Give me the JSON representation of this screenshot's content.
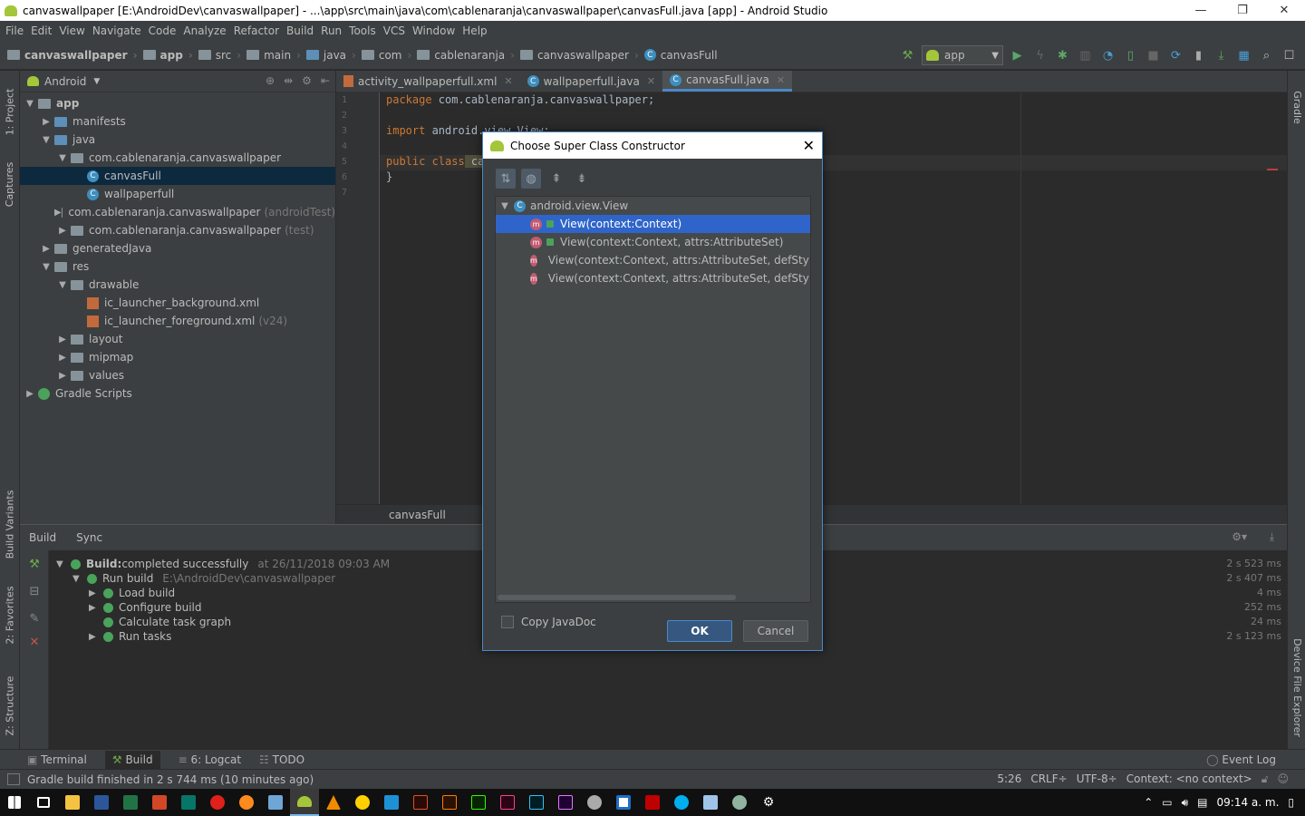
{
  "window": {
    "title": "canvaswallpaper [E:\\AndroidDev\\canvaswallpaper] - ...\\app\\src\\main\\java\\com\\cablenaranja\\canvaswallpaper\\canvasFull.java [app] - Android Studio",
    "minimize": "—",
    "maximize": "❐",
    "close": "✕"
  },
  "menu": [
    "File",
    "Edit",
    "View",
    "Navigate",
    "Code",
    "Analyze",
    "Refactor",
    "Build",
    "Run",
    "Tools",
    "VCS",
    "Window",
    "Help"
  ],
  "breadcrumbs": [
    "canvaswallpaper",
    "app",
    "src",
    "main",
    "java",
    "com",
    "cablenaranja",
    "canvaswallpaper",
    "canvasFull"
  ],
  "run_config": "app",
  "left_tabs": {
    "project": "1: Project",
    "captures": "Captures",
    "build_variants": "Build Variants",
    "favorites": "2: Favorites",
    "structure": "Z: Structure"
  },
  "right_tabs": {
    "gradle": "Gradle",
    "device_file_explorer": "Device File Explorer"
  },
  "project_panel": {
    "view_mode": "Android",
    "tree": [
      {
        "label": "app",
        "level": 0,
        "arrow": "▼",
        "icon": "folder",
        "bold": true
      },
      {
        "label": "manifests",
        "level": 1,
        "arrow": "▶",
        "icon": "folder-blue"
      },
      {
        "label": "java",
        "level": 1,
        "arrow": "▼",
        "icon": "folder-blue"
      },
      {
        "label": "com.cablenaranja.canvaswallpaper",
        "level": 2,
        "arrow": "▼",
        "icon": "package"
      },
      {
        "label": "canvasFull",
        "level": 3,
        "arrow": "",
        "icon": "class",
        "selected": true
      },
      {
        "label": "wallpaperfull",
        "level": 3,
        "arrow": "",
        "icon": "class"
      },
      {
        "label": "com.cablenaranja.canvaswallpaper",
        "level": 2,
        "arrow": "▶",
        "icon": "package",
        "suffix": "(androidTest)"
      },
      {
        "label": "com.cablenaranja.canvaswallpaper",
        "level": 2,
        "arrow": "▶",
        "icon": "package",
        "suffix": "(test)"
      },
      {
        "label": "generatedJava",
        "level": 1,
        "arrow": "▶",
        "icon": "folder"
      },
      {
        "label": "res",
        "level": 1,
        "arrow": "▼",
        "icon": "folder"
      },
      {
        "label": "drawable",
        "level": 2,
        "arrow": "▼",
        "icon": "folder"
      },
      {
        "label": "ic_launcher_background.xml",
        "level": 3,
        "arrow": "",
        "icon": "xml"
      },
      {
        "label": "ic_launcher_foreground.xml",
        "level": 3,
        "arrow": "",
        "icon": "xml",
        "suffix": "(v24)"
      },
      {
        "label": "layout",
        "level": 2,
        "arrow": "▶",
        "icon": "folder"
      },
      {
        "label": "mipmap",
        "level": 2,
        "arrow": "▶",
        "icon": "folder"
      },
      {
        "label": "values",
        "level": 2,
        "arrow": "▶",
        "icon": "folder"
      },
      {
        "label": "Gradle Scripts",
        "level": 0,
        "arrow": "▶",
        "icon": "gradle"
      }
    ]
  },
  "editor_tabs": [
    {
      "label": "activity_wallpaperfull.xml",
      "icon": "xml",
      "active": false
    },
    {
      "label": "wallpaperfull.java",
      "icon": "class",
      "active": false
    },
    {
      "label": "canvasFull.java",
      "icon": "class",
      "active": true
    }
  ],
  "code": {
    "line_numbers": [
      "1",
      "2",
      "3",
      "4",
      "5",
      "6",
      "7"
    ],
    "line1_kw": "package",
    "line1_rest": " com.cablenaranja.canvaswallpaper;",
    "line3_kw": "import",
    "line3_rest": " android.view.View;",
    "line5_kw": "public class",
    "line5_rest": " ca",
    "line6": "}"
  },
  "editor_breadcrumb": "canvasFull",
  "build_panel": {
    "tabs": [
      "Build",
      "Sync"
    ],
    "rows": [
      {
        "label": "Build:",
        "rest": " completed successfully",
        "time": "at 26/11/2018 09:03 AM",
        "arrow": "▼",
        "duration": "2 s 523 ms"
      },
      {
        "label": "Run build",
        "rest": "",
        "time": "E:\\AndroidDev\\canvaswallpaper",
        "arrow": "▼",
        "duration": "2 s 407 ms"
      },
      {
        "label": "Load build",
        "rest": "",
        "time": "",
        "arrow": "▶",
        "duration": "4 ms"
      },
      {
        "label": "Configure build",
        "rest": "",
        "time": "",
        "arrow": "▶",
        "duration": "252 ms"
      },
      {
        "label": "Calculate task graph",
        "rest": "",
        "time": "",
        "arrow": "",
        "duration": "24 ms"
      },
      {
        "label": "Run tasks",
        "rest": "",
        "time": "",
        "arrow": "▶",
        "duration": "2 s 123 ms"
      }
    ]
  },
  "bottom_tabs": [
    "Terminal",
    "Build",
    "6: Logcat",
    "TODO"
  ],
  "event_log": "Event Log",
  "status": {
    "message": "Gradle build finished in 2 s 744 ms (10 minutes ago)",
    "position": "5:26",
    "line_sep": "CRLF÷",
    "encoding": "UTF-8÷",
    "context": "Context: <no context>"
  },
  "taskbar": {
    "time": "09:14 a. m."
  },
  "dialog": {
    "title": "Choose Super Class Constructor",
    "parent": "android.view.View",
    "items": [
      {
        "label": "View(context:Context)",
        "selected": true
      },
      {
        "label": "View(context:Context, attrs:AttributeSet)",
        "selected": false
      },
      {
        "label": "View(context:Context, attrs:AttributeSet, defStyleAttr",
        "selected": false
      },
      {
        "label": "View(context:Context, attrs:AttributeSet, defStyleAttr",
        "selected": false
      }
    ],
    "copy_javadoc": "Copy JavaDoc",
    "ok": "OK",
    "cancel": "Cancel"
  },
  "colors": {
    "accent": "#4a88c7",
    "selection": "#2f65ca",
    "success": "#4aa35a",
    "android": "#a4c639"
  }
}
